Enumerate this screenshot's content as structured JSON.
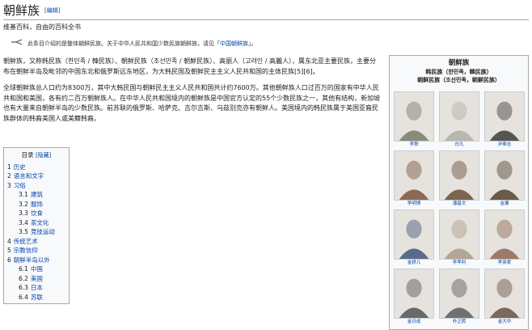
{
  "header": {
    "title": "朝鲜族",
    "edit_label": "[编辑]",
    "tagline": "维基百科，自由的百科全书"
  },
  "hatnote": {
    "icon": "disambiguation-icon",
    "text": "此条目介绍的是整体朝鲜民族。关于中华人民共和国少数民族朝鲜族，请见「",
    "link": "中国朝鲜族",
    "end": "」。"
  },
  "main": {
    "p1": "朝鲜族，又称韩民族（한민족 / 韓民族）、朝鲜民族（조선민족 / 朝鮮民族）、高丽人（고려인 / 高麗人），属东北亚主要民族，主要分布在朝鲜半岛及毗邻的中国东北和俄罗斯远东地区，为大韩民国及朝鲜民主主义人民共和国的主体民族[5][6]。",
    "p2": "全球朝鲜族总人口约为8300万，其中大韩民国与朝鲜民主主义人民共和国共计约7600万。其他朝鲜族人口过百万的国家有中华人民共和国和美国，各有约二百万朝鲜族人。在中华人民共和国境内的朝鲜族是中国官方认定的55个少数民族之一，其他有结构，新加坡也有大量来自朝鲜半岛的少数民族。前苏联的俄罗斯、哈萨克、吉尔吉斯、乌兹别克亦有朝鲜人。美国境内的韩民族属于美国亚裔民族群体的韩裔美国人或美籍韩裔。"
  },
  "toc": {
    "title": "目录",
    "toggle": "[隐藏]",
    "items": [
      {
        "num": "1",
        "label": "历史",
        "sub": false
      },
      {
        "num": "2",
        "label": "语言和文字",
        "sub": false
      },
      {
        "num": "3",
        "label": "习俗",
        "sub": false
      },
      {
        "num": "3.1",
        "label": "建筑",
        "sub": true
      },
      {
        "num": "3.2",
        "label": "服饰",
        "sub": true
      },
      {
        "num": "3.3",
        "label": "饮食",
        "sub": true
      },
      {
        "num": "3.4",
        "label": "茶文化",
        "sub": true
      },
      {
        "num": "3.5",
        "label": "竞技运动",
        "sub": true
      },
      {
        "num": "4",
        "label": "传统艺术",
        "sub": false
      },
      {
        "num": "5",
        "label": "宗教信仰",
        "sub": false
      },
      {
        "num": "6",
        "label": "朝鲜半岛以外",
        "sub": false
      },
      {
        "num": "6.1",
        "label": "中国",
        "sub": true
      },
      {
        "num": "6.2",
        "label": "美国",
        "sub": true
      },
      {
        "num": "6.3",
        "label": "日本",
        "sub": true
      },
      {
        "num": "6.4",
        "label": "苏联",
        "sub": true
      }
    ]
  },
  "infobox": {
    "title": "朝鲜族",
    "subtitle1": "韩民族（한민족，韓民族）",
    "subtitle2": "朝鲜民族（조선민족，朝鮮民族）",
    "people": [
      {
        "caption": "李舜",
        "tone": "#8a8a7a"
      },
      {
        "caption": "白凡",
        "tone": "#b8b8b0"
      },
      {
        "caption": "尹奉吉",
        "tone": "#555555"
      },
      {
        "caption": "李明博",
        "tone": "#8a6a55"
      },
      {
        "caption": "潘基文",
        "tone": "#7a6550"
      },
      {
        "caption": "金墉",
        "tone": "#6a5a4a"
      },
      {
        "caption": "金妍儿",
        "tone": "#5a6a8a"
      },
      {
        "caption": "李孝利",
        "tone": "#b5a595"
      },
      {
        "caption": "李英爱",
        "tone": "#9a7a6a"
      },
      {
        "caption": "金日成",
        "tone": "#6a6a6a"
      },
      {
        "caption": "朴正熙",
        "tone": "#707070"
      },
      {
        "caption": "金大中",
        "tone": "#7a6a5a"
      }
    ]
  }
}
